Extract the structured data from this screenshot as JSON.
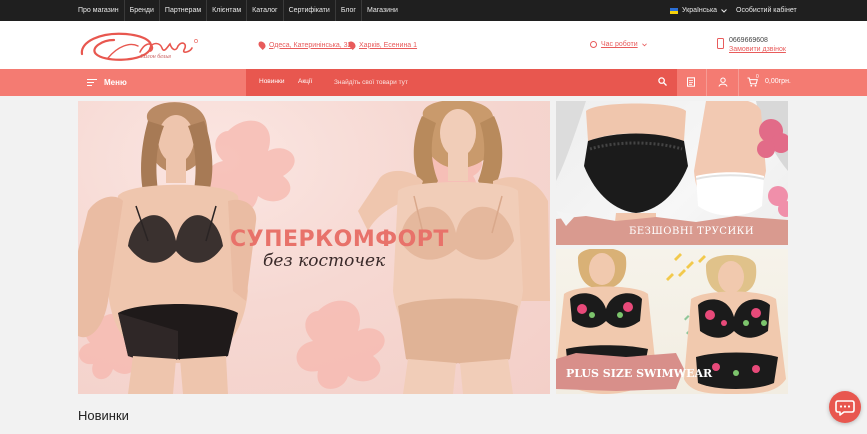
{
  "topbar": {
    "nav": [
      "Про магазин",
      "Бренди",
      "Партнерам",
      "Клієнтам",
      "Каталог",
      "Сертифікати",
      "Блог",
      "Магазини"
    ],
    "language": "Українська",
    "cabinet": "Особистий кабінет"
  },
  "header": {
    "logo_subtitle": "Салон белья",
    "address_1": "Одеса, Катеринінська, 32",
    "address_2": "Харків, Есенина 1",
    "hours": "Час роботи",
    "phone": "0669669608",
    "callback": "Замовити дзвінок"
  },
  "navbar": {
    "menu": "Меню",
    "link_new": "Новинки",
    "link_sale": "Акції",
    "search_placeholder": "Знайдіть свої товари тут",
    "cart_count": "0",
    "cart_total": "0,00грн."
  },
  "banners": {
    "main_title": "СУПЕРКОМФОРТ",
    "main_subtitle": "без косточек",
    "side_1_caption": "БЕЗШОВНІ ТРУСИКИ",
    "side_2_caption": "PLUS SIZE SWIMWEAR"
  },
  "section": {
    "title": "Новинки"
  },
  "colors": {
    "accent": "#f47b72",
    "accent_dark": "#e8574f",
    "topbar": "#1f1f1f"
  }
}
